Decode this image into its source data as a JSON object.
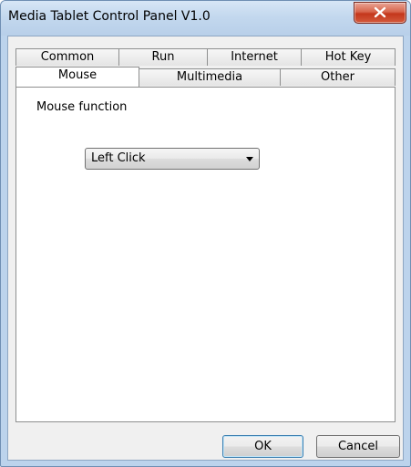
{
  "window": {
    "title": "Media Tablet Control Panel V1.0"
  },
  "tabs": {
    "row_back": [
      {
        "id": "common",
        "label": "Common"
      },
      {
        "id": "run",
        "label": "Run"
      },
      {
        "id": "internet",
        "label": "Internet"
      },
      {
        "id": "hotkey",
        "label": "Hot Key"
      }
    ],
    "row_front": [
      {
        "id": "mouse",
        "label": "Mouse",
        "active": true
      },
      {
        "id": "multimedia",
        "label": "Multimedia"
      },
      {
        "id": "other",
        "label": "Other"
      }
    ]
  },
  "panel": {
    "label": "Mouse function",
    "select": {
      "value": "Left Click"
    }
  },
  "buttons": {
    "ok": "OK",
    "cancel": "Cancel"
  },
  "icons": {
    "close": "close-icon",
    "dropdown": "chevron-down-icon"
  }
}
